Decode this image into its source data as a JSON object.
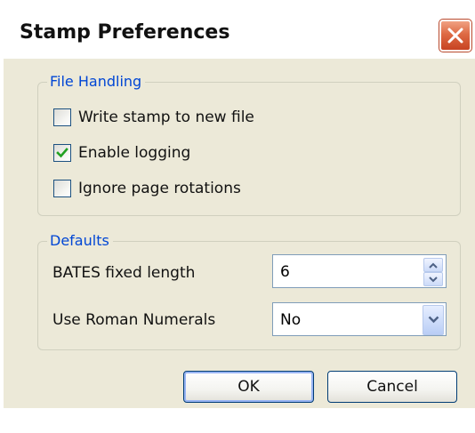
{
  "dialog": {
    "title": "Stamp Preferences",
    "close_icon": "close-icon"
  },
  "file_handling": {
    "legend": "File Handling",
    "options": [
      {
        "label": "Write stamp to new file",
        "checked": false
      },
      {
        "label": "Enable logging",
        "checked": true
      },
      {
        "label": "Ignore page rotations",
        "checked": false
      }
    ]
  },
  "defaults": {
    "legend": "Defaults",
    "bates_label": "BATES fixed length",
    "bates_value": "6",
    "roman_label": "Use Roman Numerals",
    "roman_value": "No"
  },
  "buttons": {
    "ok": "OK",
    "cancel": "Cancel"
  },
  "colors": {
    "legend_text": "#0046d5",
    "dialog_face": "#ece9d8",
    "close_button": "#de6a44",
    "check_mark": "#21a121"
  }
}
